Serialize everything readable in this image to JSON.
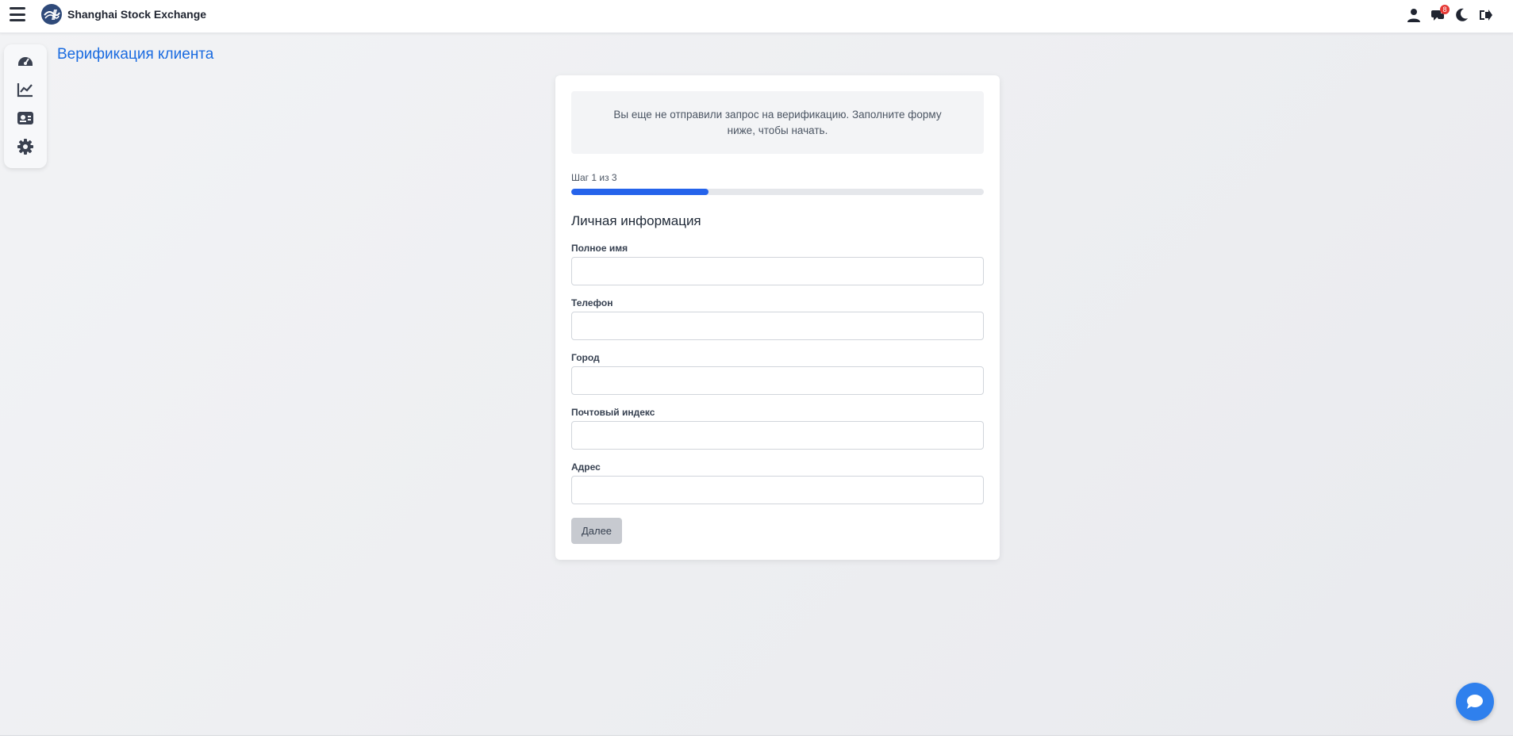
{
  "header": {
    "brand": "Shanghai Stock Exchange",
    "notifications_count": "8",
    "icons": [
      "menu-icon",
      "user-icon",
      "notifications-icon",
      "moon-icon",
      "logout-icon"
    ]
  },
  "sidebar": {
    "items": [
      {
        "icon": "dashboard-icon"
      },
      {
        "icon": "chart-line-icon"
      },
      {
        "icon": "id-card-icon"
      },
      {
        "icon": "gear-icon"
      }
    ]
  },
  "page": {
    "title": "Верификация клиента"
  },
  "form": {
    "notice": "Вы еще не отправили запрос на верификацию. Заполните форму ниже, чтобы начать.",
    "step_label": "Шаг 1 из 3",
    "progress_fraction": 0.333,
    "section_title": "Личная информация",
    "fields": [
      {
        "label": "Полное имя",
        "value": ""
      },
      {
        "label": "Телефон",
        "value": ""
      },
      {
        "label": "Город",
        "value": ""
      },
      {
        "label": "Почтовый индекс",
        "value": ""
      },
      {
        "label": "Адрес",
        "value": ""
      }
    ],
    "next_label": "Далее"
  },
  "colors": {
    "accent": "#1a6be0",
    "progress": "#2563eb",
    "chat": "#2f80ed",
    "badge": "#e53935"
  }
}
